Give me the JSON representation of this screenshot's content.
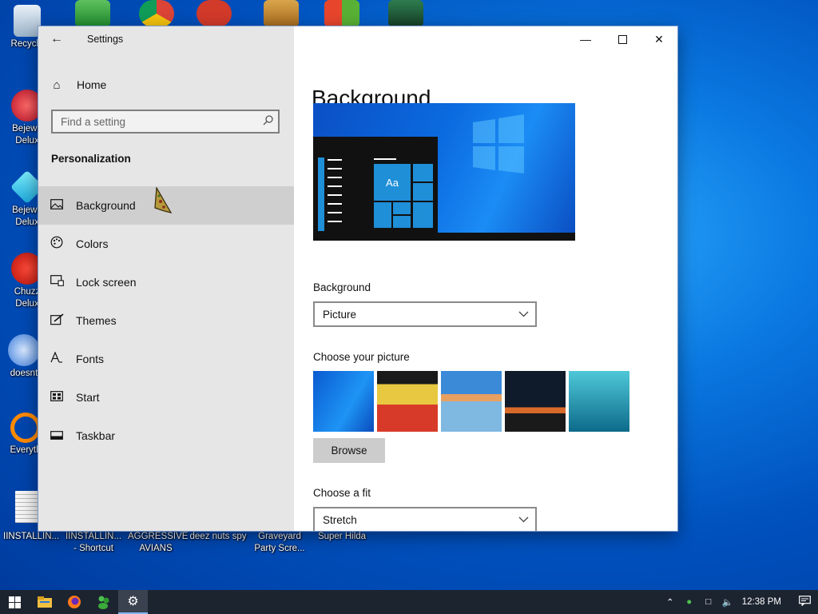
{
  "desktop": {
    "left_icons": [
      {
        "label": "Recycle",
        "icon": "recycle-bin-icon"
      },
      {
        "label": "Bejewe\nDelux",
        "icon": "bejeweled-2-icon"
      },
      {
        "label": "Bejewe\nDelux",
        "icon": "bejeweled-icon"
      },
      {
        "label": "Chuzz\nDelux",
        "icon": "chuzzle-icon"
      },
      {
        "label": "doesnt",
        "icon": "doesnt-icon"
      },
      {
        "label": "Everyth",
        "icon": "everything-search-icon"
      },
      {
        "label": "",
        "icon": "document-icon"
      }
    ],
    "bottom_icons": [
      {
        "label": "IINSTALLIN...",
        "icon": "installer-icon"
      },
      {
        "label": "IINSTALLIN...\n- Shortcut",
        "icon": "installer-shortcut-icon"
      },
      {
        "label": "AGGRESSIVE\nAVIANS",
        "icon": "aggressive-avians-icon"
      },
      {
        "label": "deez nuts spy",
        "icon": "deez-nuts-spy-icon"
      },
      {
        "label": "Graveyard\nParty Scre...",
        "icon": "graveyard-party-icon"
      },
      {
        "label": "Super Hilda",
        "icon": "super-hilda-icon"
      }
    ],
    "top_icons": [
      "messenger-icon",
      "chrome-icon",
      "app-red-icon",
      "archive-icon",
      "office-icon",
      "game-character-icon"
    ]
  },
  "settings": {
    "title": "Settings",
    "home": "Home",
    "search_placeholder": "Find a setting",
    "section": "Personalization",
    "nav": [
      {
        "label": "Background",
        "icon": "picture-icon",
        "selected": true
      },
      {
        "label": "Colors",
        "icon": "palette-icon",
        "selected": false
      },
      {
        "label": "Lock screen",
        "icon": "lock-screen-icon",
        "selected": false
      },
      {
        "label": "Themes",
        "icon": "brush-icon",
        "selected": false
      },
      {
        "label": "Fonts",
        "icon": "fonts-icon",
        "selected": false
      },
      {
        "label": "Start",
        "icon": "start-icon",
        "selected": false
      },
      {
        "label": "Taskbar",
        "icon": "taskbar-icon",
        "selected": false
      }
    ],
    "page_title": "Background",
    "preview_sample_text": "Aa",
    "background_label": "Background",
    "background_value": "Picture",
    "choose_picture_label": "Choose your picture",
    "browse_label": "Browse",
    "choose_fit_label": "Choose a fit",
    "fit_value": "Stretch",
    "thumbnails": [
      "windows-blue-wallpaper",
      "cartoon-character-wallpaper",
      "beach-rocks-wallpaper",
      "night-sky-tent-wallpaper",
      "underwater-swimmer-wallpaper"
    ]
  },
  "taskbar": {
    "items": [
      {
        "icon": "windows-start-icon",
        "active": false
      },
      {
        "icon": "file-explorer-icon",
        "active": false
      },
      {
        "icon": "firefox-icon",
        "active": false
      },
      {
        "icon": "messenger-icon",
        "active": false
      },
      {
        "icon": "settings-gear-icon",
        "active": true
      }
    ],
    "tray": [
      "chevron-up-icon",
      "people-icon",
      "network-icon",
      "volume-icon"
    ],
    "clock": "12:38 PM",
    "notification_icon": "action-center-icon"
  },
  "colors": {
    "accent": "#0078d7",
    "nav_bg": "#e6e6e6",
    "selected_bg": "#cfcfcf",
    "taskbar_bg": "#1c2430"
  }
}
